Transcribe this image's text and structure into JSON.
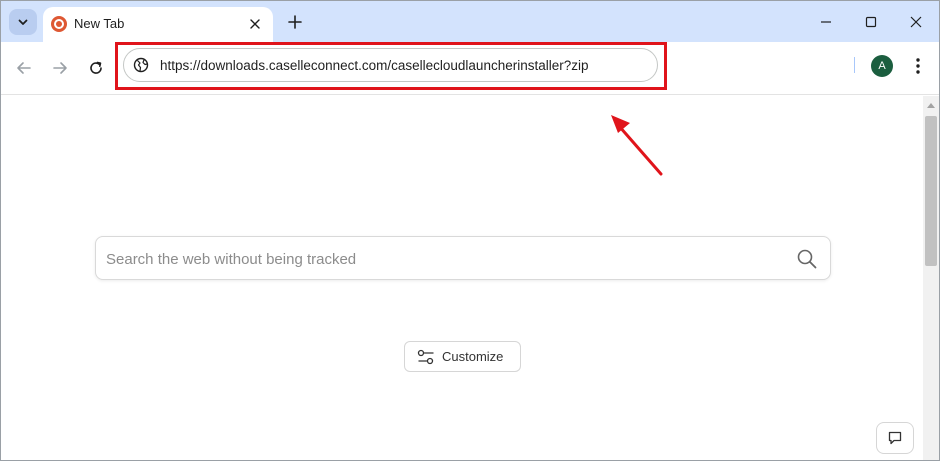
{
  "tab": {
    "title": "New Tab",
    "favicon": "duckduckgo-favicon"
  },
  "toolbar": {
    "url": "https://downloads.caselleconnect.com/casellecloudlauncherinstaller?zip",
    "avatar_letter": "A"
  },
  "content": {
    "search_placeholder": "Search the web without being tracked",
    "customize_label": "Customize"
  },
  "colors": {
    "tabstrip_bg": "#d3e3fd",
    "highlight": "#e0141b",
    "avatar_bg": "#1b5e3f",
    "duckduckgo_orange": "#de5833"
  },
  "icons": {
    "tab_search": "chevron-down-icon",
    "tab_close": "close-icon",
    "new_tab": "plus-icon",
    "minimize": "minimize-icon",
    "maximize": "maximize-icon",
    "close_window": "close-icon",
    "back": "arrow-left-icon",
    "forward": "arrow-right-icon",
    "reload": "reload-icon",
    "site_info": "globe-icon",
    "menu": "kebab-menu-icon",
    "search": "search-icon",
    "customize": "sliders-icon",
    "feedback": "chat-bubble-icon"
  }
}
